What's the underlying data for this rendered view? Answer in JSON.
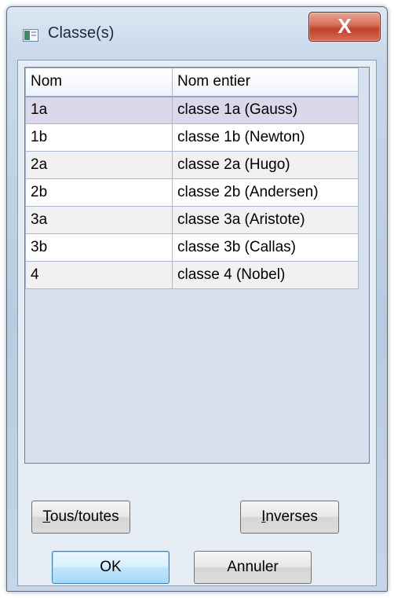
{
  "window": {
    "title": "Classe(s)",
    "close_glyph": "X"
  },
  "grid": {
    "columns": [
      "Nom",
      "Nom entier"
    ],
    "rows": [
      [
        "1a",
        "classe 1a (Gauss)"
      ],
      [
        "1b",
        "classe 1b (Newton)"
      ],
      [
        "2a",
        "classe 2a (Hugo)"
      ],
      [
        "2b",
        "classe 2b (Andersen)"
      ],
      [
        "3a",
        "classe 3a (Aristote)"
      ],
      [
        "3b",
        "classe 3b (Callas)"
      ],
      [
        "4",
        "classe 4 (Nobel)"
      ]
    ],
    "selected_row": 0
  },
  "buttons": {
    "all": {
      "mnemonic": "T",
      "rest": "ous/toutes"
    },
    "invert": {
      "mnemonic": "I",
      "rest": "nverses"
    },
    "ok": "OK",
    "cancel": "Annuler"
  },
  "icons": {
    "app": "window-app-icon",
    "close": "close-icon"
  },
  "colors": {
    "close_button": "#c9503a",
    "selected_row": "#dad8ea",
    "grid_background": "#d7e1ee"
  }
}
